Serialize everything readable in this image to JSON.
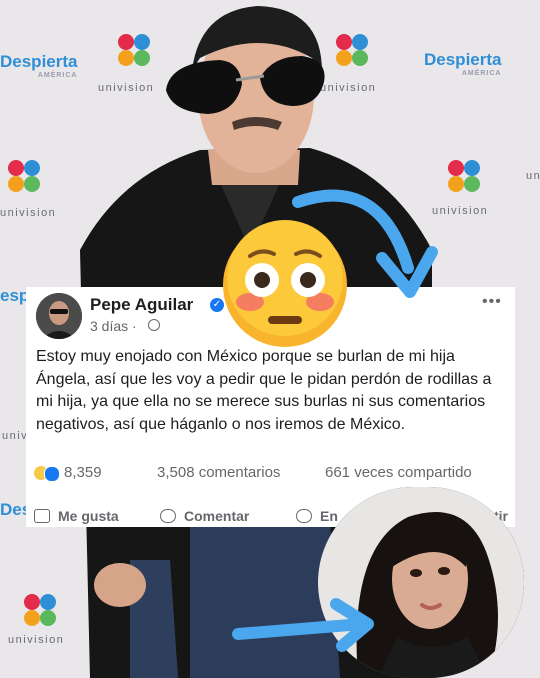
{
  "background": {
    "brand_words": [
      "univision",
      "univision",
      "univision",
      "univision",
      "univision",
      "univision",
      "univision",
      "univision"
    ],
    "show_names": [
      "Despierta",
      "Despierta",
      "espierta",
      "Des"
    ],
    "show_tagline": "AMÉRICA",
    "colors": {
      "backdrop": "#e9e7ea",
      "brand_text": "#6c6c74",
      "show_blue": "#2f8fd6",
      "arrow_blue": "#4aa7ee"
    }
  },
  "post": {
    "author": "Pepe Aguilar",
    "verified": true,
    "time": "3 días ·",
    "text": "Estoy muy enojado con México porque se burlan de mi hija Ángela, así que les voy a pedir que le pidan perdón de rodillas a mi hija, ya que ella no se merece sus burlas ni sus comentarios negativos, así que háganlo o nos iremos de México.",
    "reactions_count": "8,359",
    "comments": "3,508 comentarios",
    "shares": "661 veces compartido",
    "more_icon": "more-dots-icon"
  },
  "actions": {
    "like": "Me gusta",
    "comment": "Comentar",
    "share_partial": "En",
    "share_tail": "tir"
  },
  "overlays": {
    "emoji": "flushed-face-emoji",
    "inset": "woman-portrait-circle"
  }
}
